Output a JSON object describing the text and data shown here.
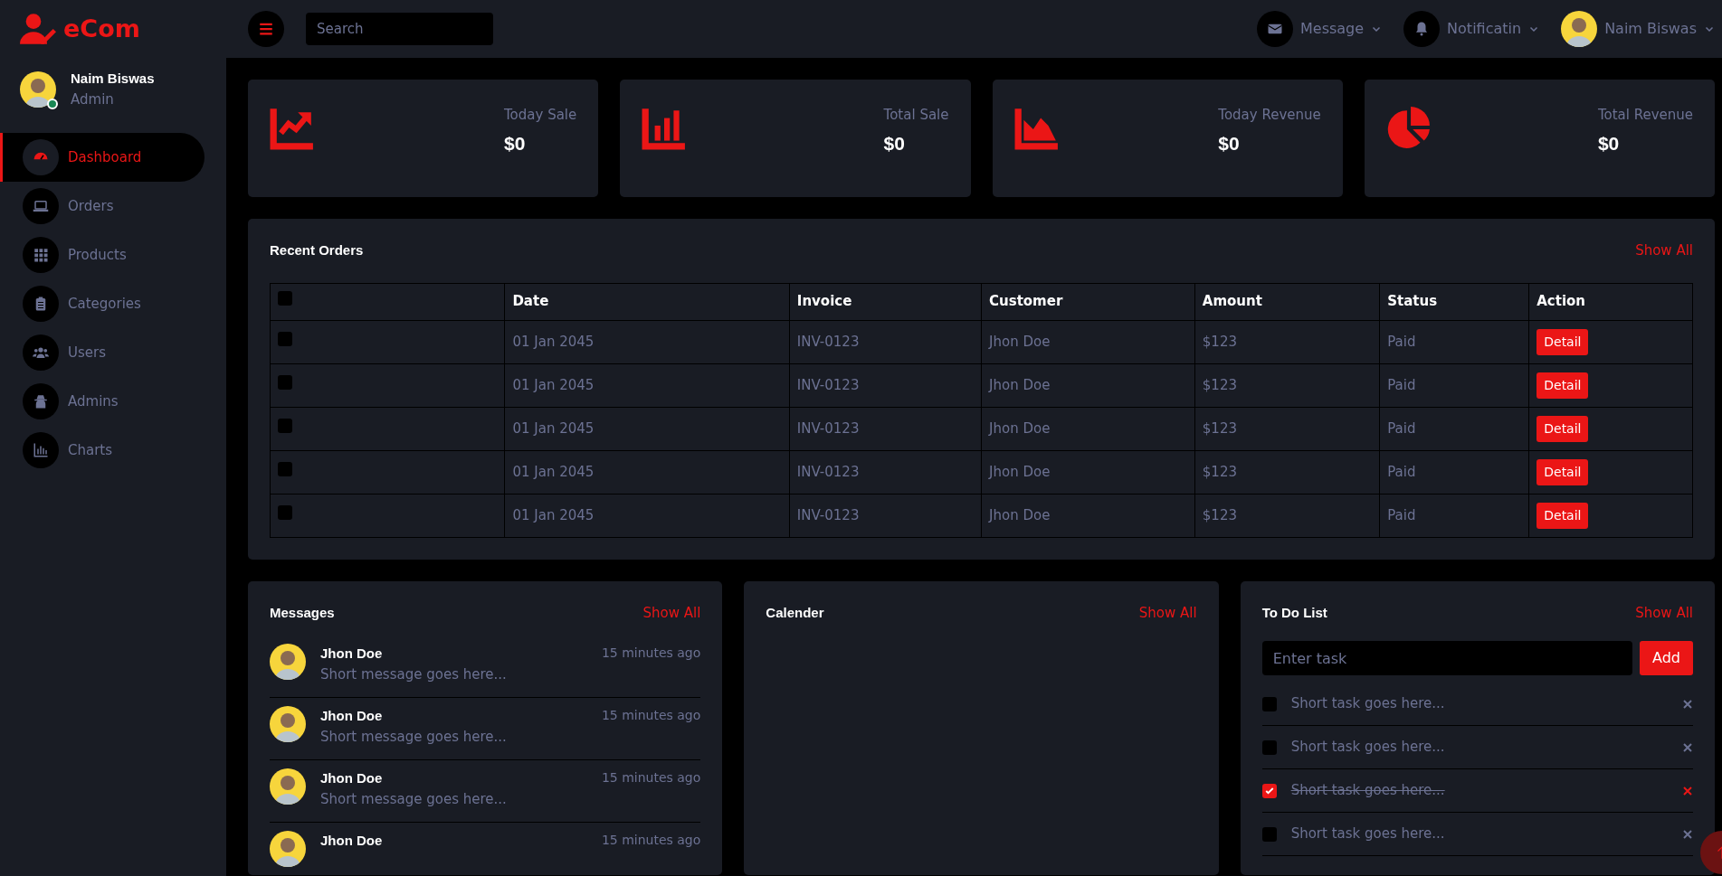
{
  "brand": "eCom",
  "user": {
    "name": "Naim Biswas",
    "role": "Admin",
    "online": true
  },
  "nav": [
    {
      "label": "Dashboard",
      "selected": true
    },
    {
      "label": "Orders",
      "selected": false
    },
    {
      "label": "Products",
      "selected": false
    },
    {
      "label": "Categories",
      "selected": false
    },
    {
      "label": "Users",
      "selected": false
    },
    {
      "label": "Admins",
      "selected": false
    },
    {
      "label": "Charts",
      "selected": false
    }
  ],
  "topbar": {
    "search_placeholder": "Search",
    "menus": [
      {
        "label": "Message",
        "kind": "icon"
      },
      {
        "label": "Notificatin",
        "kind": "icon"
      },
      {
        "label": "Naim Biswas",
        "kind": "avatar"
      }
    ]
  },
  "stats": [
    {
      "label": "Today Sale",
      "value": "$0"
    },
    {
      "label": "Total Sale",
      "value": "$0"
    },
    {
      "label": "Today Revenue",
      "value": "$0"
    },
    {
      "label": "Total Revenue",
      "value": "$0"
    }
  ],
  "recent_orders": {
    "title": "Recent Orders",
    "show_all": "Show All",
    "header_checked": false,
    "columns": [
      "Date",
      "Invoice",
      "Customer",
      "Amount",
      "Status",
      "Action"
    ],
    "rows": [
      {
        "checked": false,
        "date": "01 Jan 2045",
        "invoice": "INV-0123",
        "customer": "Jhon Doe",
        "amount": "$123",
        "status": "Paid",
        "action": "Detail"
      },
      {
        "checked": false,
        "date": "01 Jan 2045",
        "invoice": "INV-0123",
        "customer": "Jhon Doe",
        "amount": "$123",
        "status": "Paid",
        "action": "Detail"
      },
      {
        "checked": false,
        "date": "01 Jan 2045",
        "invoice": "INV-0123",
        "customer": "Jhon Doe",
        "amount": "$123",
        "status": "Paid",
        "action": "Detail"
      },
      {
        "checked": false,
        "date": "01 Jan 2045",
        "invoice": "INV-0123",
        "customer": "Jhon Doe",
        "amount": "$123",
        "status": "Paid",
        "action": "Detail"
      },
      {
        "checked": false,
        "date": "01 Jan 2045",
        "invoice": "INV-0123",
        "customer": "Jhon Doe",
        "amount": "$123",
        "status": "Paid",
        "action": "Detail"
      }
    ]
  },
  "messages": {
    "title": "Messages",
    "show_all": "Show All",
    "items": [
      {
        "name": "Jhon Doe",
        "time": "15 minutes ago",
        "text": "Short message goes here..."
      },
      {
        "name": "Jhon Doe",
        "time": "15 minutes ago",
        "text": "Short message goes here..."
      },
      {
        "name": "Jhon Doe",
        "time": "15 minutes ago",
        "text": "Short message goes here..."
      },
      {
        "name": "Jhon Doe",
        "time": "15 minutes ago"
      }
    ]
  },
  "calendar": {
    "title": "Calender",
    "show_all": "Show All"
  },
  "todo": {
    "title": "To Do List",
    "show_all": "Show All",
    "placeholder": "Enter task",
    "add": "Add",
    "items": [
      {
        "text": "Short task goes here...",
        "checked": false
      },
      {
        "text": "Short task goes here...",
        "checked": false
      },
      {
        "text": "Short task goes here...",
        "checked": true
      },
      {
        "text": "Short task goes here...",
        "checked": false
      }
    ]
  }
}
